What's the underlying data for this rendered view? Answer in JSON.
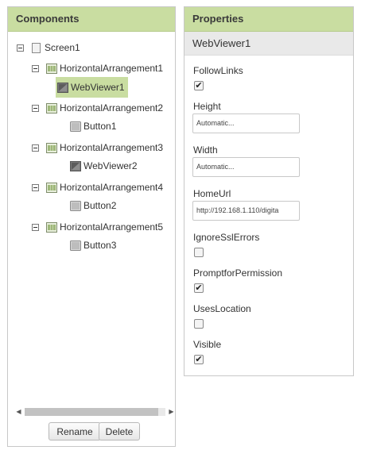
{
  "components": {
    "title": "Components",
    "tree": [
      {
        "label": "Screen1",
        "icon": "screen-icon"
      },
      {
        "label": "HorizontalArrangement1",
        "icon": "arrangement-icon"
      },
      {
        "label": "WebViewer1",
        "icon": "webviewer-icon",
        "selected": true
      },
      {
        "label": "HorizontalArrangement2",
        "icon": "arrangement-icon"
      },
      {
        "label": "Button1",
        "icon": "button-icon"
      },
      {
        "label": "HorizontalArrangement3",
        "icon": "arrangement-icon"
      },
      {
        "label": "WebViewer2",
        "icon": "webviewer-icon"
      },
      {
        "label": "HorizontalArrangement4",
        "icon": "arrangement-icon"
      },
      {
        "label": "Button2",
        "icon": "button-icon"
      },
      {
        "label": "HorizontalArrangement5",
        "icon": "arrangement-icon"
      },
      {
        "label": "Button3",
        "icon": "button-icon"
      }
    ],
    "rename_label": "Rename",
    "delete_label": "Delete"
  },
  "properties": {
    "title": "Properties",
    "component_name": "WebViewer1",
    "follow_links": {
      "label": "FollowLinks",
      "checked": true
    },
    "height": {
      "label": "Height",
      "value": "Automatic..."
    },
    "width": {
      "label": "Width",
      "value": "Automatic..."
    },
    "home_url": {
      "label": "HomeUrl",
      "value": "http://192.168.1.110/digita"
    },
    "ignore_ssl_errors": {
      "label": "IgnoreSslErrors",
      "checked": false
    },
    "prompt_for_permission": {
      "label": "PromptforPermission",
      "checked": true
    },
    "uses_location": {
      "label": "UsesLocation",
      "checked": false
    },
    "visible": {
      "label": "Visible",
      "checked": true
    }
  },
  "colors": {
    "header_bg": "#c9dda1",
    "selected_bg": "#c9dda1",
    "subheader_bg": "#e9e9e9"
  }
}
